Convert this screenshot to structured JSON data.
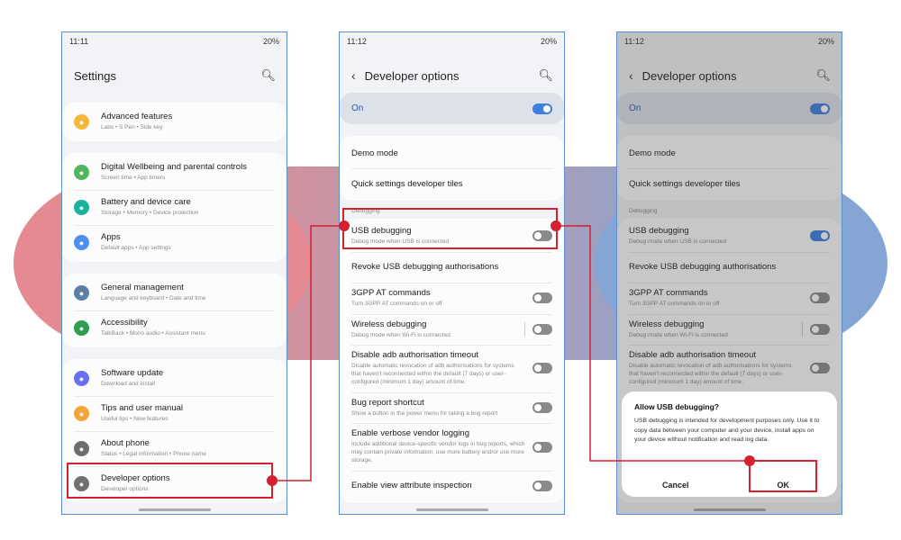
{
  "colors": {
    "accent": "#3e7fe0",
    "annotation": "#d4202f",
    "frame": "#5b8fd1"
  },
  "status": {
    "p1_time": "11:11",
    "p2_time": "11:12",
    "p3_time": "11:12",
    "battery": "20%"
  },
  "settings": {
    "title": "Settings",
    "search_icon": "search-icon",
    "groups": [
      [
        {
          "title": "Advanced features",
          "sub": "Labs  •  S Pen  •  Side key",
          "icon": "gear-plus-icon",
          "color": "#f5b73b"
        }
      ],
      [
        {
          "title": "Digital Wellbeing and parental controls",
          "sub": "Screen time  •  App timers",
          "icon": "wellbeing-icon",
          "color": "#52b45f"
        },
        {
          "title": "Battery and device care",
          "sub": "Storage  •  Memory  •  Device protection",
          "icon": "device-care-icon",
          "color": "#1ab39b"
        },
        {
          "title": "Apps",
          "sub": "Default apps  •  App settings",
          "icon": "apps-icon",
          "color": "#4d8ff0"
        }
      ],
      [
        {
          "title": "General management",
          "sub": "Language and keyboard  •  Date and time",
          "icon": "sliders-icon",
          "color": "#5c7fa8"
        },
        {
          "title": "Accessibility",
          "sub": "TalkBack  •  Mono audio  •  Assistant menu",
          "icon": "accessibility-icon",
          "color": "#2f9c4f"
        }
      ],
      [
        {
          "title": "Software update",
          "sub": "Download and install",
          "icon": "software-update-icon",
          "color": "#6a6ef0"
        },
        {
          "title": "Tips and user manual",
          "sub": "Useful tips  •  New features",
          "icon": "lightbulb-icon",
          "color": "#f5a33b"
        },
        {
          "title": "About phone",
          "sub": "Status  •  Legal information  •  Phone name",
          "icon": "info-icon",
          "color": "#6d6d6d"
        },
        {
          "title": "Developer options",
          "sub": "Developer options",
          "icon": "developer-braces-icon",
          "color": "#707070"
        }
      ]
    ]
  },
  "dev": {
    "title": "Developer options",
    "on_label": "On",
    "debug_section": "Debugging",
    "top": [
      {
        "title": "Demo mode"
      },
      {
        "title": "Quick settings developer tiles"
      }
    ],
    "debug": [
      {
        "title": "USB debugging",
        "sub": "Debug mode when USB is connected",
        "toggle": false
      },
      {
        "title": "Revoke USB debugging authorisations"
      },
      {
        "title": "3GPP AT commands",
        "sub": "Turn 3GPP AT commands on or off",
        "toggle": false
      },
      {
        "title": "Wireless debugging",
        "sub": "Debug mode when Wi-Fi is connected",
        "toggle": false,
        "sep": true
      },
      {
        "title": "Disable adb authorisation timeout",
        "sub": "Disable automatic revocation of adb authorisations for systems that haven't reconnected within the default (7 days) or user-configured (minimum 1 day) amount of time.",
        "toggle": false
      },
      {
        "title": "Bug report shortcut",
        "sub": "Show a button in the power menu for taking a bug report",
        "toggle": false
      },
      {
        "title": "Enable verbose vendor logging",
        "sub": "Include additional device-specific vendor logs in bug reports, which may contain private information, use more battery and/or use more storage.",
        "toggle": false
      },
      {
        "title": "Enable view attribute inspection",
        "toggle": false
      }
    ]
  },
  "dialog": {
    "title": "Allow USB debugging?",
    "body": "USB debugging is intended for development purposes only. Use it to copy data between your computer and your device, install apps on your device without notification and read log data.",
    "cancel": "Cancel",
    "ok": "OK"
  }
}
